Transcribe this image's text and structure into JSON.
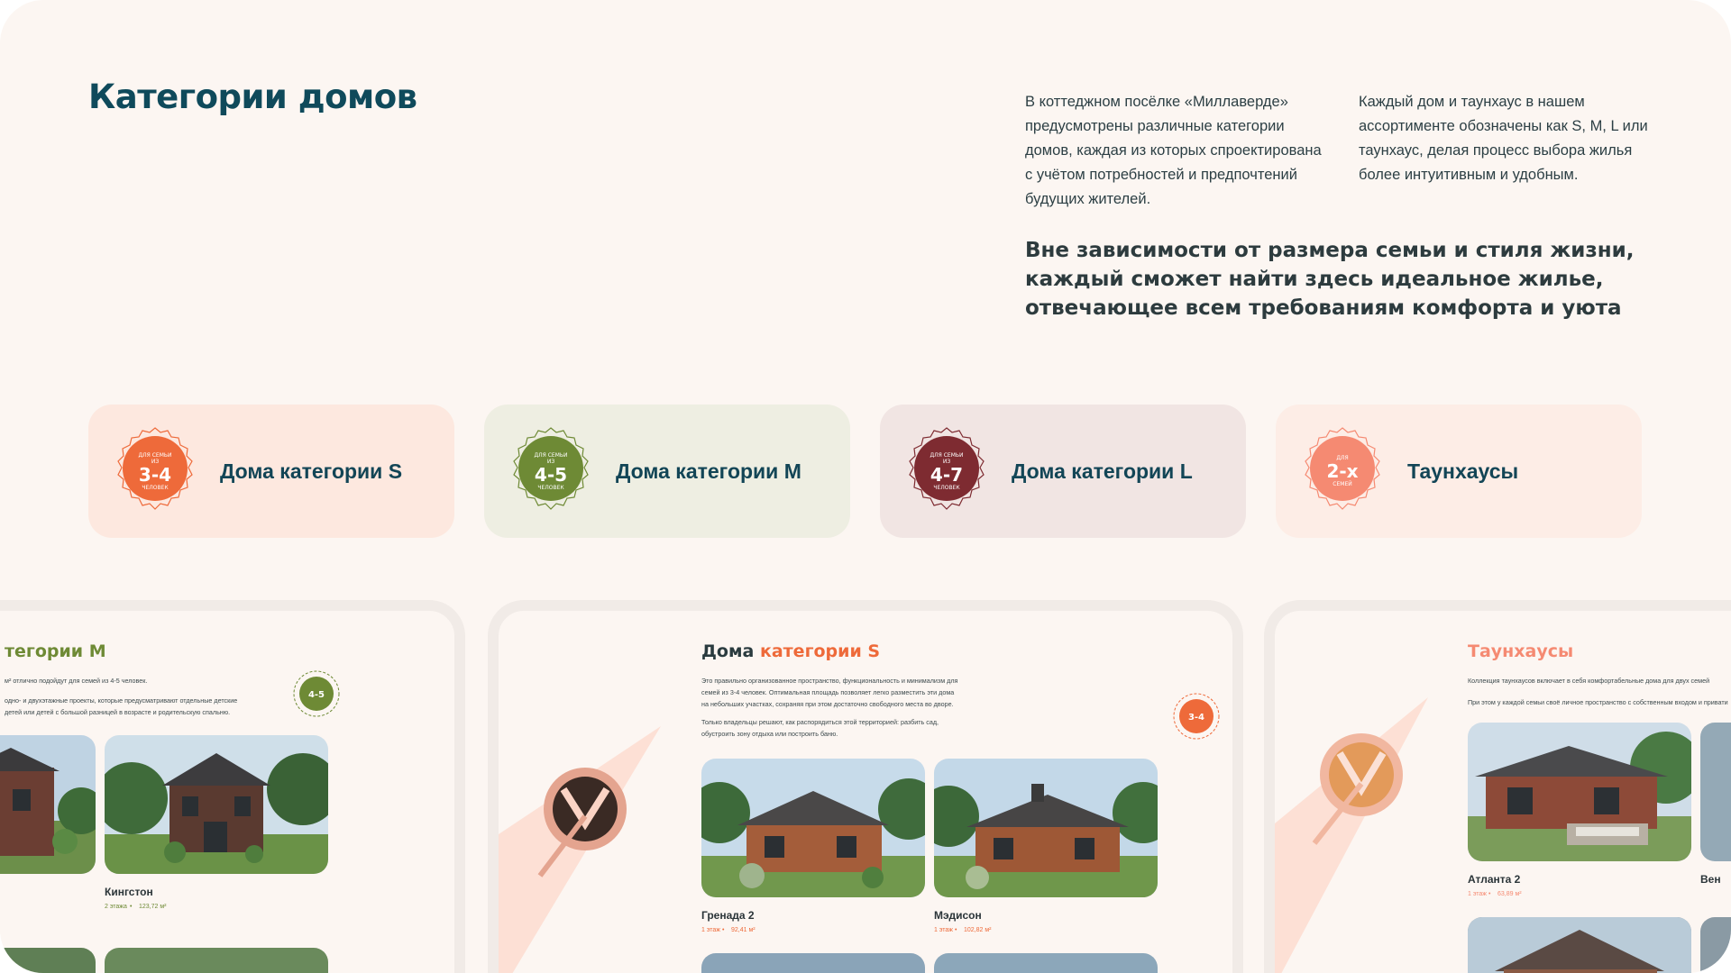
{
  "header": {
    "title": "Категории домов"
  },
  "intro": {
    "paragraph_left": "В коттеджном посёлке «Миллаверде» предусмотрены различные категории домов, каждая из которых спроектирована с учётом потребностей и предпочтений будущих жителей.",
    "paragraph_right": "Каждый дом и таунхаус в нашем ассортименте обозначены как S, M, L или таунхаус, делая процесс выбора жилья более интуитивным и удобным.",
    "quote": "Вне зависимости от размера семьи и стиля жизни, каждый сможет найти здесь идеальное жилье, отвечающее всем требованиям комфорта и уюта"
  },
  "categories": [
    {
      "label": "Дома категории S",
      "badge_top": "ДЛЯ СЕМЬИ ИЗ",
      "badge_num": "3-4",
      "badge_bottom": "ЧЕЛОВЕК",
      "color": "#ee6a3a",
      "bg": "#fde8df"
    },
    {
      "label": "Дома категории M",
      "badge_top": "ДЛЯ СЕМЬИ ИЗ",
      "badge_num": "4-5",
      "badge_bottom": "ЧЕЛОВЕК",
      "color": "#6e8a35",
      "bg": "#eeeee2"
    },
    {
      "label": "Дома категории L",
      "badge_top": "ДЛЯ СЕМЬИ ИЗ",
      "badge_num": "4-7",
      "badge_bottom": "ЧЕЛОВЕК",
      "color": "#7e2b31",
      "bg": "#f1e5e3"
    },
    {
      "label": "Таунхаусы",
      "badge_top": "ДЛЯ",
      "badge_num": "2-х",
      "badge_bottom": "СЕМЕЙ",
      "color": "#f58a72",
      "bg": "#fdede6"
    }
  ],
  "previews": {
    "m": {
      "title": "тегории M",
      "desc1": "м² отлично подойдут для семей из 4-5 человек.",
      "desc2": "одно- и двухэтажные проекты, которые предусматривают отдельные детские",
      "desc3": "детей или детей с большой разницей в возрасте и родительскую спальню.",
      "house": {
        "name": "Кингстон",
        "meta1": "2 этажа",
        "meta2": "123,72 м²"
      }
    },
    "s": {
      "title_a": "Дома",
      "title_b": "категории S",
      "desc1": "Это правильно организованное пространство, функциональность и минимализм для",
      "desc2": "семей из 3-4 человек. Оптимальная площадь позволяет легко разместить эти дома",
      "desc3": "на небольших участках, сохраняя при этом достаточно свободного места во дворе.",
      "desc4": "Только владельцы решают, как распорядиться этой территорией: разбить сад,",
      "desc5": "обустроить зону отдыха или построить баню.",
      "houses": [
        {
          "name": "Гренада 2",
          "meta1": "1 этаж",
          "meta2": "92,41 м²"
        },
        {
          "name": "Мэдисон",
          "meta1": "1 этаж",
          "meta2": "102,82 м²"
        }
      ]
    },
    "t": {
      "title": "Таунхаусы",
      "desc1": "Коллекция таунхаусов включает в себя комфортабельные дома для двух семей",
      "desc2": "При этом у каждой семьи своё личное пространство с собственным входом и привати",
      "houses": [
        {
          "name": "Атланта 2",
          "meta1": "1 этаж",
          "meta2": "63,89 м²"
        },
        {
          "name": "Вен",
          "meta1": "",
          "meta2": ""
        }
      ]
    }
  },
  "colors": {
    "brand": "#0f4a5b",
    "orange": "#ee6a3a",
    "green": "#6e8a35",
    "burgundy": "#7e2b31",
    "peach": "#f58a72"
  }
}
